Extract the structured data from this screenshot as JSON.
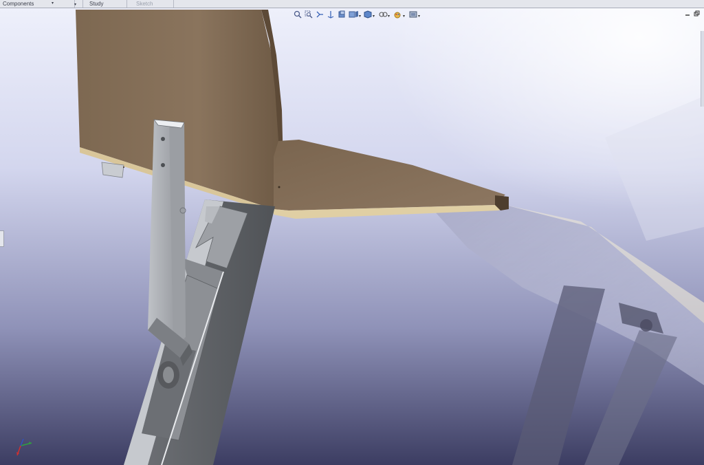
{
  "command_tabs": [
    {
      "label": "Components",
      "has_dropdown": true,
      "dropdown_only": false
    },
    {
      "label": "",
      "has_dropdown": true,
      "dropdown_only": true
    },
    {
      "label": "Study",
      "has_dropdown": false,
      "dropdown_only": false
    },
    {
      "label": "Sketch",
      "has_dropdown": false,
      "dropdown_only": false,
      "disabled": true
    }
  ],
  "heads_up_toolbar": [
    "zoom-to-fit-icon",
    "zoom-to-area-icon",
    "previous-view-icon",
    "section-view-icon",
    "view-orientation-icon",
    "display-style-icon",
    "hide-show-items-icon",
    "edit-appearance-icon",
    "apply-scene-icon",
    "view-settings-icon"
  ],
  "colors": {
    "wood_face": "#85705a",
    "wood_edge": "#e0cfa4",
    "steel_light": "#cfd2d6",
    "steel_dark": "#6b6e73",
    "background_top": "#eef0fb",
    "background_bottom": "#3c3d62"
  }
}
